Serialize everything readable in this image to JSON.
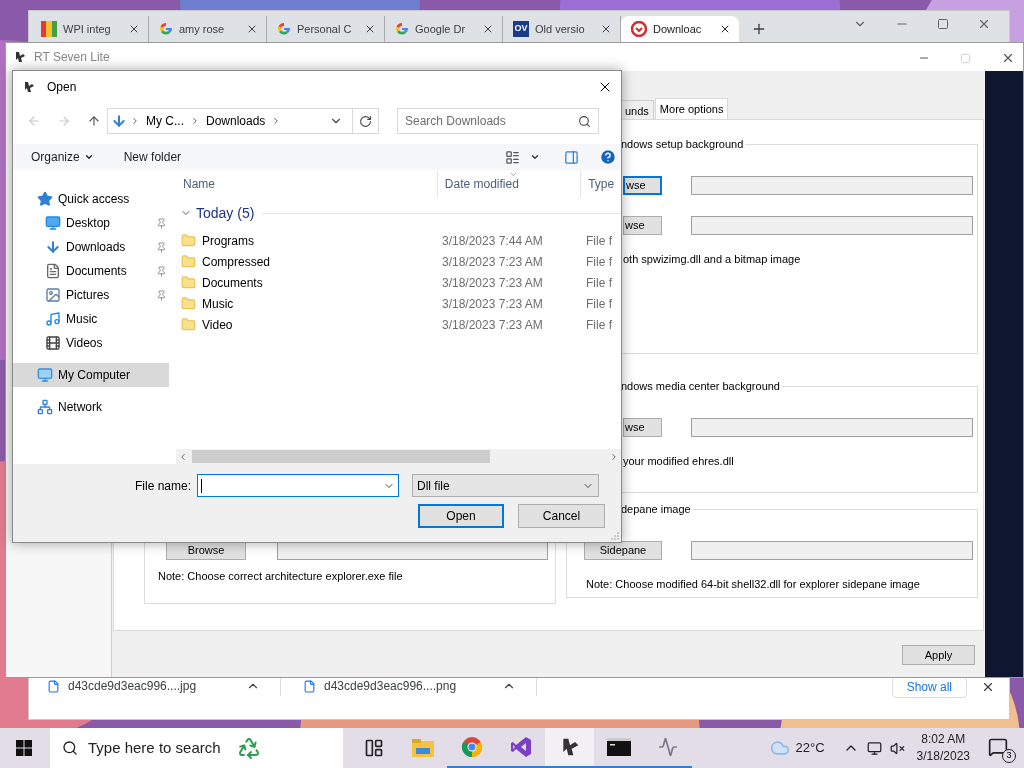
{
  "browser": {
    "tabs": [
      {
        "label": "WPI integ",
        "kind": "tiles",
        "selected": false
      },
      {
        "label": "amy rose",
        "kind": "google",
        "selected": false
      },
      {
        "label": "Personal C",
        "kind": "google",
        "selected": false
      },
      {
        "label": "Google Dr",
        "kind": "google",
        "selected": false
      },
      {
        "label": "Old versio",
        "kind": "text",
        "icon_text": "OV",
        "selected": false
      },
      {
        "label": "Downloac",
        "kind": "download",
        "selected": true
      }
    ],
    "downloads": [
      {
        "name": "d43cde9d3eac996....jpg"
      },
      {
        "name": "d43cde9d3eac996....png"
      }
    ],
    "show_all": "Show all"
  },
  "app_window": {
    "title": "RT Seven Lite",
    "maximize_disabled": true,
    "tabs": [
      {
        "label": "unds",
        "selected": false
      },
      {
        "label": "More options",
        "selected": true
      }
    ],
    "left_groups": [
      {
        "rows": [
          {
            "button": "Browse",
            "focused": false
          }
        ],
        "note": "Note: Choose correct architecture explorer.exe file"
      }
    ],
    "right_groups": [
      {
        "label": "ndows setup background",
        "rows": [
          {
            "button": "wse",
            "focused": true
          },
          {
            "button": "wse",
            "focused": false
          }
        ],
        "note": "oth spwizimg.dll and a bitmap image"
      },
      {
        "label": "ndows media center background",
        "rows": [
          {
            "button": "wse",
            "focused": false
          }
        ],
        "note": "your modified ehres.dll"
      },
      {
        "label": "depane image",
        "rows": [
          {
            "button": "Sidepane",
            "focused": false
          }
        ],
        "note": "Note: Choose modified 64-bit shell32.dll for explorer sidepane image"
      }
    ],
    "apply": "Apply"
  },
  "dialog": {
    "title": "Open",
    "path": [
      "My C...",
      "Downloads"
    ],
    "search": {
      "placeholder": "Search Downloads"
    },
    "toolbar": {
      "organize": "Organize",
      "new_folder": "New folder"
    },
    "nav": [
      {
        "label": "Quick access",
        "kind": "star",
        "selected": false,
        "children": [
          {
            "label": "Desktop",
            "kind": "desktop",
            "pinned": true,
            "selected": false
          },
          {
            "label": "Downloads",
            "kind": "download",
            "pinned": true,
            "selected": false
          },
          {
            "label": "Documents",
            "kind": "document",
            "pinned": true,
            "selected": false
          },
          {
            "label": "Pictures",
            "kind": "picture",
            "pinned": true,
            "selected": false
          },
          {
            "label": "Music",
            "kind": "music",
            "pinned": false,
            "selected": false
          },
          {
            "label": "Videos",
            "kind": "video",
            "pinned": false,
            "selected": false
          }
        ]
      },
      {
        "label": "My Computer",
        "kind": "computer",
        "selected": true
      },
      {
        "label": "Network",
        "kind": "network",
        "selected": false
      }
    ],
    "columns": [
      {
        "label": "Name",
        "sorted": false
      },
      {
        "label": "Date modified",
        "sorted": true
      },
      {
        "label": "Type",
        "sorted": false
      }
    ],
    "groups": [
      {
        "label": "Today (5)",
        "expanded": true,
        "files": [
          {
            "name": "Programs",
            "date": "3/18/2023 7:44 AM",
            "type": "File f"
          },
          {
            "name": "Compressed",
            "date": "3/18/2023 7:23 AM",
            "type": "File f"
          },
          {
            "name": "Documents",
            "date": "3/18/2023 7:23 AM",
            "type": "File f"
          },
          {
            "name": "Music",
            "date": "3/18/2023 7:23 AM",
            "type": "File f"
          },
          {
            "name": "Video",
            "date": "3/18/2023 7:23 AM",
            "type": "File f"
          }
        ]
      }
    ],
    "file_name_label": "File name:",
    "file_type": "Dll file",
    "open": "Open",
    "cancel": "Cancel"
  },
  "taskbar": {
    "search_placeholder": "Type here to search",
    "apps": [
      {
        "kind": "taskview",
        "running": false,
        "active": false
      },
      {
        "kind": "explorer",
        "running": false,
        "active": false
      },
      {
        "kind": "chrome",
        "running": true,
        "active": false
      },
      {
        "kind": "vs",
        "running": true,
        "active": false
      },
      {
        "kind": "rt",
        "running": true,
        "active": true
      },
      {
        "kind": "cmd",
        "running": true,
        "active": false
      },
      {
        "kind": "monitor",
        "running": true,
        "active": false
      }
    ],
    "temperature": "22°C",
    "time": "8:02 AM",
    "date": "3/18/2023",
    "notifications": "3"
  }
}
